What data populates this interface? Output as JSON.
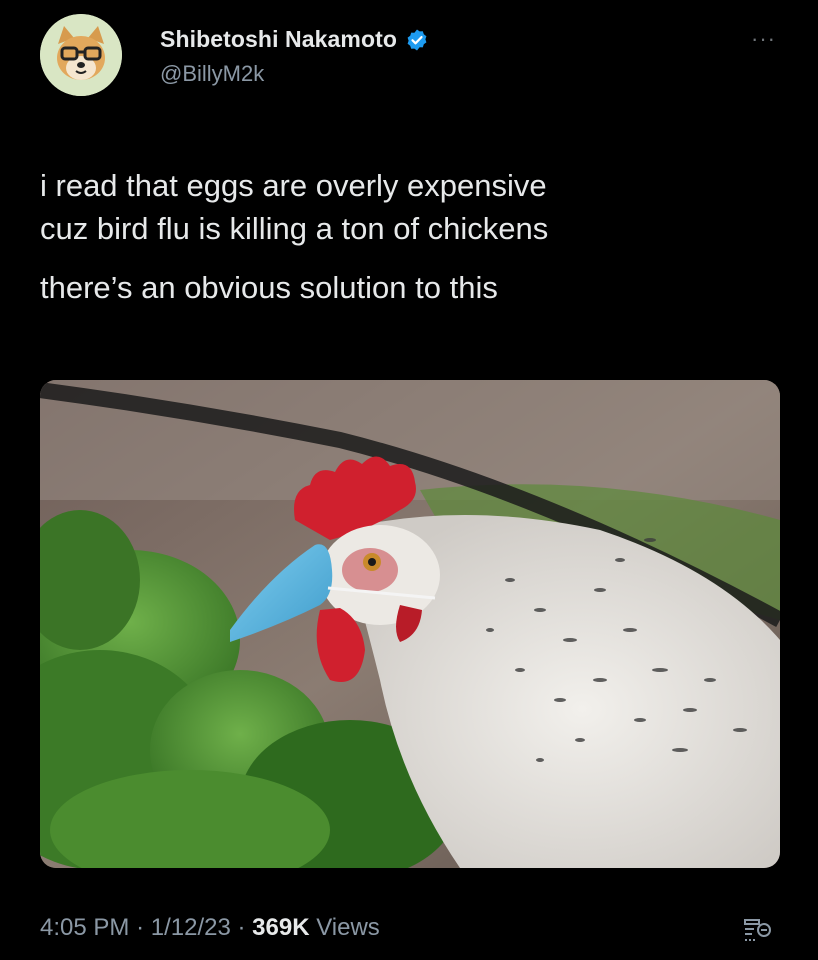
{
  "author": {
    "display_name": "Shibetoshi Nakamoto",
    "handle": "@BillyM2k",
    "avatar_icon": "shiba-dog-with-glasses-icon",
    "verified_icon": "verified-badge-icon",
    "verified_color": "#1d9bf0"
  },
  "tweet": {
    "line1": "i read that eggs are overly expensive",
    "line2": "cuz bird flu is killing a ton of chickens",
    "line3": "there’s an obvious solution to this"
  },
  "media": {
    "description_icon": "photo-chicken-wearing-face-mask"
  },
  "meta": {
    "time": "4:05 PM",
    "separator": "·",
    "date": "1/12/23",
    "views_count": "369K",
    "views_label": "Views"
  },
  "menu": {
    "more_label": "···"
  },
  "colors": {
    "background": "#000000",
    "text": "#e7e9ea",
    "secondary": "#8b98a5",
    "mask": "#5ab4dc",
    "comb": "#d0202e"
  }
}
